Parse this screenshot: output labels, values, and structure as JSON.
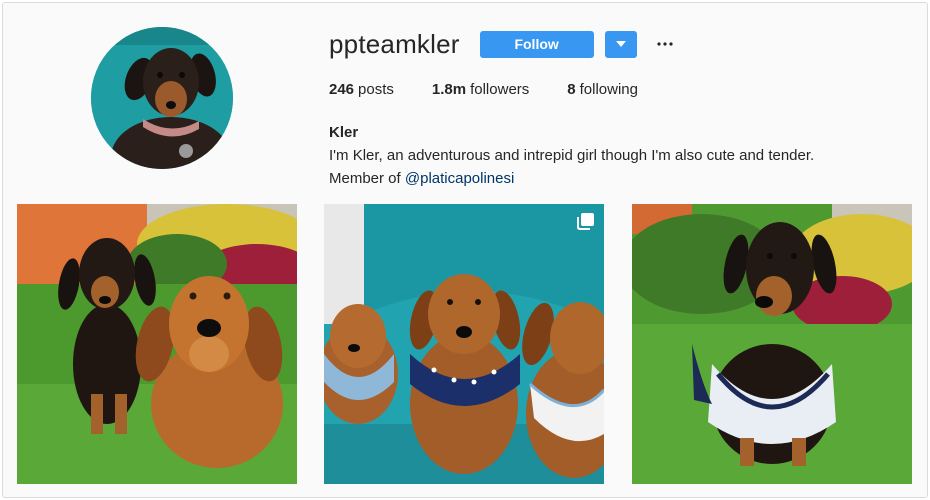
{
  "profile": {
    "username": "ppteamkler",
    "follow_label": "Follow",
    "stats": {
      "posts_count": "246",
      "posts_label": "posts",
      "followers_count": "1.8m",
      "followers_label": "followers",
      "following_count": "8",
      "following_label": "following"
    },
    "bio": {
      "name": "Kler",
      "text": "I'm Kler, an adventurous and intrepid girl though I'm also cute and tender.",
      "member_prefix": "Member of",
      "member_link": "@platicapolinesi"
    }
  },
  "icons": {
    "dropdown": "chevron-down-icon",
    "more": "more-options-icon",
    "multi_post": "carousel-icon"
  },
  "colors": {
    "accent": "#3897f0",
    "link": "#003569",
    "background": "#fafafa",
    "text": "#262626"
  }
}
